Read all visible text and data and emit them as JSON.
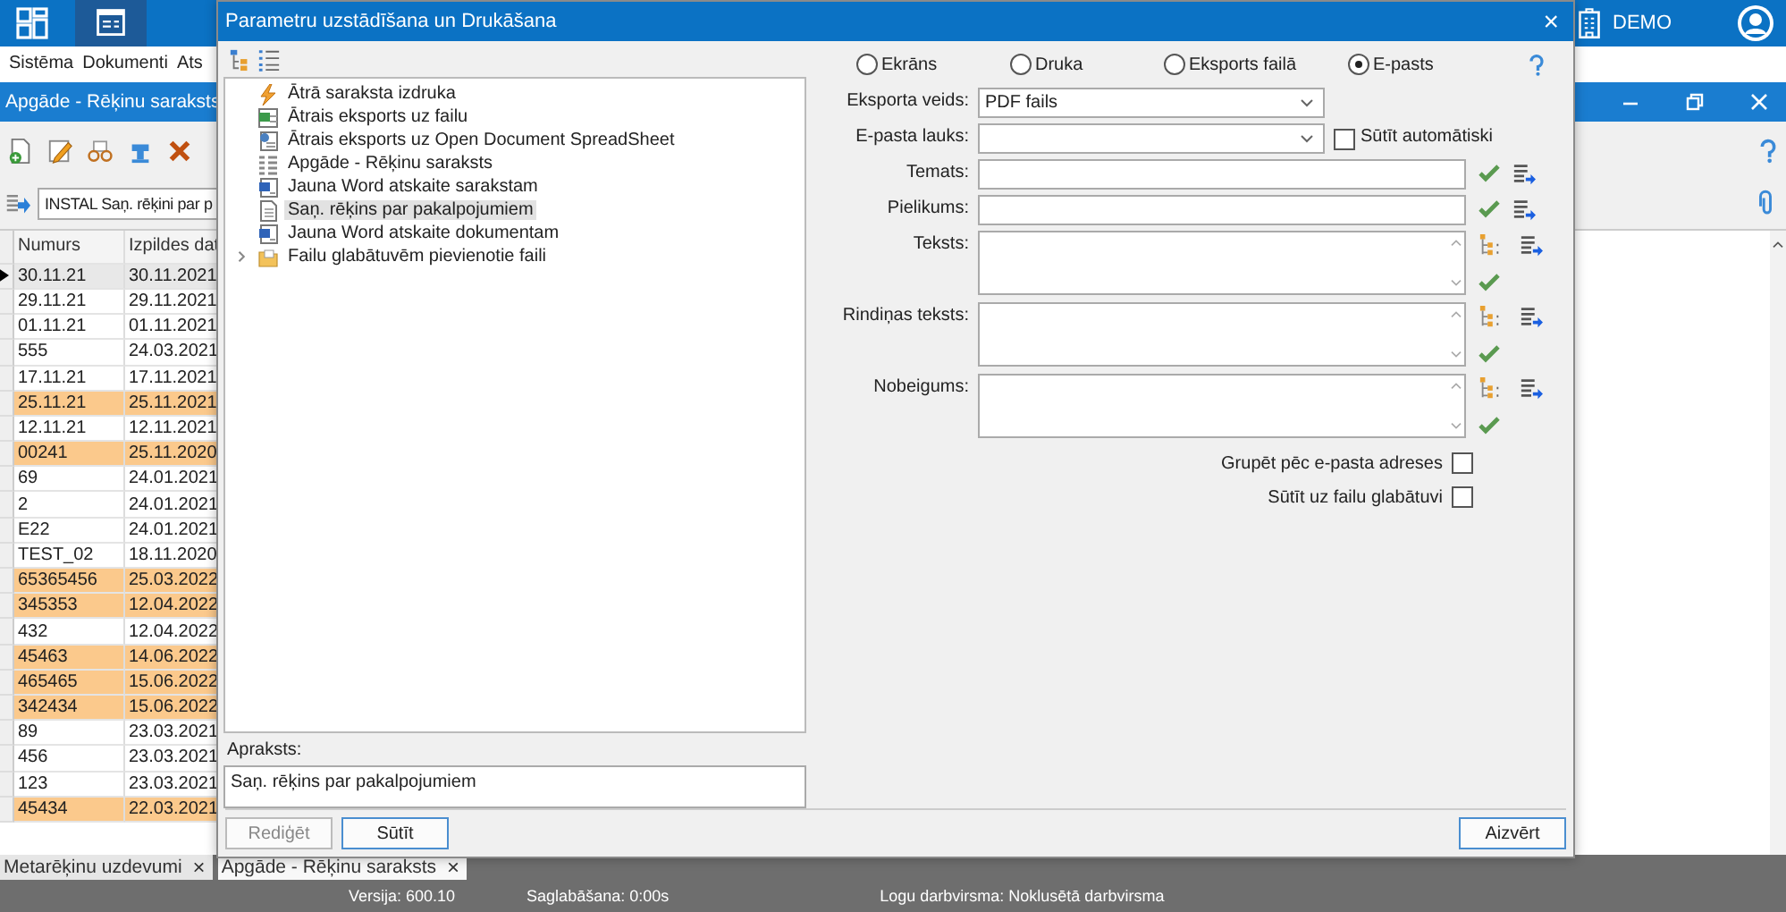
{
  "app": {
    "user": "DEMO",
    "menu": [
      "Sistēma",
      "Dokumenti",
      "Ats"
    ],
    "document_title": "Apgāde - Rēķinu saraksts",
    "filter": "INSTAL Saņ. rēķini par p"
  },
  "table": {
    "columns": [
      "Numurs",
      "Izpildes dat"
    ],
    "rows": [
      {
        "number": "30.11.21",
        "date": "30.11.2021",
        "highlight": false,
        "selected": true
      },
      {
        "number": "29.11.21",
        "date": "29.11.2021",
        "highlight": false,
        "selected": false
      },
      {
        "number": "01.11.21",
        "date": "01.11.2021",
        "highlight": false,
        "selected": false
      },
      {
        "number": "555",
        "date": "24.03.2021",
        "highlight": false,
        "selected": false
      },
      {
        "number": "17.11.21",
        "date": "17.11.2021",
        "highlight": false,
        "selected": false
      },
      {
        "number": "25.11.21",
        "date": "25.11.2021",
        "highlight": true,
        "selected": false
      },
      {
        "number": "12.11.21",
        "date": "12.11.2021",
        "highlight": false,
        "selected": false
      },
      {
        "number": "00241",
        "date": "25.11.2020",
        "highlight": true,
        "selected": false
      },
      {
        "number": "69",
        "date": "24.01.2021",
        "highlight": false,
        "selected": false
      },
      {
        "number": "2",
        "date": "24.01.2021",
        "highlight": false,
        "selected": false
      },
      {
        "number": "E22",
        "date": "24.01.2021",
        "highlight": false,
        "selected": false
      },
      {
        "number": "TEST_02",
        "date": "18.11.2020",
        "highlight": false,
        "selected": false
      },
      {
        "number": "65365456",
        "date": "25.03.2022",
        "highlight": true,
        "selected": false
      },
      {
        "number": "345353",
        "date": "12.04.2022",
        "highlight": true,
        "selected": false
      },
      {
        "number": "432",
        "date": "12.04.2022",
        "highlight": false,
        "selected": false
      },
      {
        "number": "45463",
        "date": "14.06.2022",
        "highlight": true,
        "selected": false
      },
      {
        "number": "465465",
        "date": "15.06.2022",
        "highlight": true,
        "selected": false
      },
      {
        "number": "342434",
        "date": "15.06.2022",
        "highlight": true,
        "selected": false
      },
      {
        "number": "89",
        "date": "23.03.2021",
        "highlight": false,
        "selected": false
      },
      {
        "number": "456",
        "date": "23.03.2021",
        "highlight": false,
        "selected": false
      },
      {
        "number": "123",
        "date": "23.03.2021",
        "highlight": false,
        "selected": false
      },
      {
        "number": "45434",
        "date": "22.03.2021",
        "highlight": true,
        "selected": false
      }
    ]
  },
  "bottom_tabs": [
    {
      "label": "Metarēķinu uzdevumi",
      "close": "×",
      "selected": false
    },
    {
      "label": "Apgāde - Rēķinu saraksts",
      "close": "×",
      "selected": true
    }
  ],
  "status_bar": [
    "Versija: 600.10",
    "Saglabāšana: 0:00s",
    "Logu darbvirsma: Noklusētā darbvirsma"
  ],
  "dialog": {
    "title": "Parametru uzstādīšana un Drukāšana",
    "close": "×",
    "tree": [
      {
        "kind": "flash",
        "label": "Ātrā saraksta izdruka",
        "selected": false
      },
      {
        "kind": "sheet",
        "label": "Ātrais eksports uz failu",
        "selected": false
      },
      {
        "kind": "ods",
        "label": "Ātrais eksports uz Open Document SpreadSheet",
        "selected": false
      },
      {
        "kind": "list",
        "label": "Apgāde - Rēķinu saraksts",
        "selected": false
      },
      {
        "kind": "word",
        "label": "Jauna Word atskaite sarakstam",
        "selected": false
      },
      {
        "kind": "page",
        "label": "Saņ. rēķins par pakalpojumiem",
        "selected": true
      },
      {
        "kind": "word",
        "label": "Jauna Word atskaite dokumentam",
        "selected": false
      },
      {
        "kind": "folder",
        "label": "Failu glabātuvēm pievienotie faili",
        "selected": false,
        "expanded": false
      }
    ],
    "description": {
      "label": "Apraksts:",
      "value": "Saņ. rēķins par pakalpojumiem"
    },
    "modes": [
      {
        "label": "Ekrāns",
        "selected": false
      },
      {
        "label": "Druka",
        "selected": false
      },
      {
        "label": "Eksports failā",
        "selected": false
      },
      {
        "label": "E-pasts",
        "selected": true
      }
    ],
    "fields": [
      {
        "kind": "select",
        "label": "Eksporta veids:",
        "value": "PDF fails"
      },
      {
        "kind": "select",
        "label": "E-pasta lauks:",
        "checkbox": {
          "label": "Sūtīt automātiski",
          "checked": false
        }
      },
      {
        "kind": "input",
        "label": "Temats:"
      },
      {
        "kind": "input",
        "label": "Pielikums:"
      },
      {
        "kind": "textarea",
        "label": "Teksts:"
      },
      {
        "kind": "textarea",
        "label": "Rindiņas teksts:"
      },
      {
        "kind": "textarea",
        "label": "Nobeigums:"
      }
    ],
    "options": [
      {
        "label": "Grupēt pēc e-pasta adreses",
        "checked": false
      },
      {
        "label": "Sūtīt uz failu glabātuvi",
        "checked": false
      }
    ],
    "buttons": [
      {
        "label": "Rediģēt",
        "disabled": true
      },
      {
        "label": "Sūtīt",
        "disabled": false
      }
    ],
    "close_button": {
      "label": "Aizvērt",
      "disabled": false
    }
  }
}
